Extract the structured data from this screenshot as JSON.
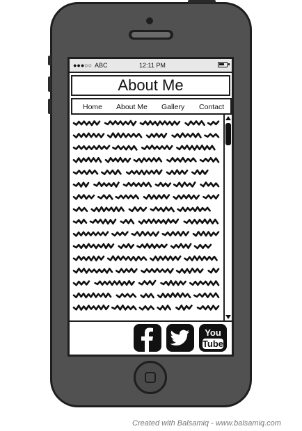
{
  "status_bar": {
    "signal": "●●●○○",
    "carrier": "ABC",
    "time": "12:11 PM"
  },
  "page": {
    "title": "About Me"
  },
  "nav": {
    "items": [
      {
        "label": "Home",
        "key": "home"
      },
      {
        "label": "About Me",
        "key": "about"
      },
      {
        "label": "Gallery",
        "key": "gallery"
      },
      {
        "label": "Contact",
        "key": "contact"
      }
    ]
  },
  "footer": {
    "social": [
      {
        "name": "facebook",
        "icon": "facebook-icon"
      },
      {
        "name": "twitter",
        "icon": "twitter-icon"
      },
      {
        "name": "youtube",
        "icon": "youtube-icon",
        "label_top": "You",
        "label_bottom": "Tube"
      }
    ]
  },
  "credit": "Created with Balsamiq - www.balsamiq.com",
  "colors": {
    "phone_body": "#515151",
    "outline": "#1e1e1e",
    "status_bar": "#e8e8e8",
    "icon_fill": "#111111"
  }
}
